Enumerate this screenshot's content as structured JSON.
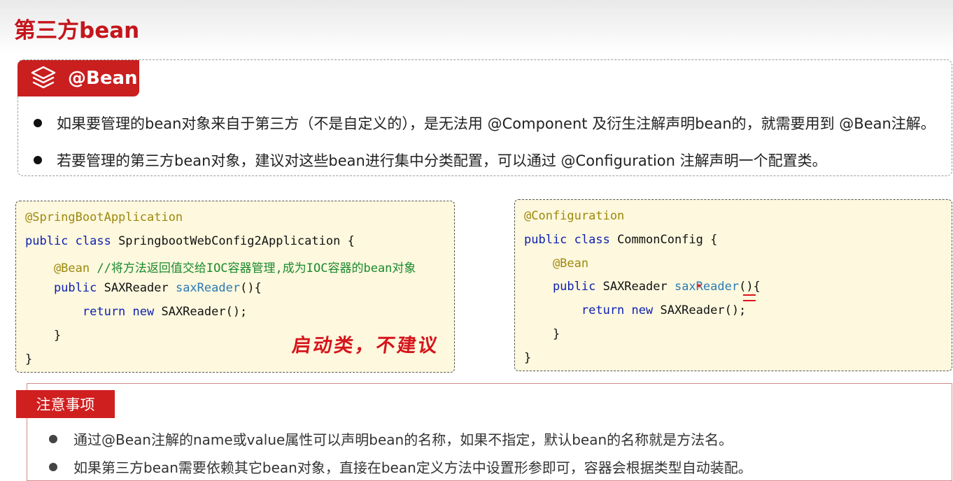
{
  "page": {
    "title": "第三方bean"
  },
  "bean_section": {
    "tab_label": "@Bean",
    "tab_icon": "layers-icon",
    "bullets": [
      "如果要管理的bean对象来自于第三方（不是自定义的），是无法用 @Component 及衍生注解声明bean的，就需要用到 @Bean注解。",
      "若要管理的第三方bean对象，建议对这些bean进行集中分类配置，可以通过 @Configuration 注解声明一个配置类。"
    ]
  },
  "code_left": {
    "lines": [
      [
        {
          "t": "@SpringBootApplication",
          "c": "ann"
        }
      ],
      [
        {
          "t": "public class ",
          "c": "kw"
        },
        {
          "t": "SpringbootWebConfig2Application {",
          "c": "pl"
        }
      ],
      [
        {
          "t": "    @Bean ",
          "c": "ann"
        },
        {
          "t": "//将方法返回值交给IOC容器管理,成为IOC容器的bean对象",
          "c": "cm"
        }
      ],
      [
        {
          "t": "    public ",
          "c": "kw"
        },
        {
          "t": "SAXReader ",
          "c": "pl"
        },
        {
          "t": "saxReader",
          "c": "fn"
        },
        {
          "t": "(){",
          "c": "pl"
        }
      ],
      [
        {
          "t": "        return new ",
          "c": "kw"
        },
        {
          "t": "SAXReader();",
          "c": "pl"
        }
      ],
      [
        {
          "t": "    }",
          "c": "pl"
        }
      ],
      [
        {
          "t": "}",
          "c": "pl"
        }
      ]
    ],
    "handwritten_note": "启动类，不建议"
  },
  "code_right": {
    "lines": [
      [
        {
          "t": "@Configuration",
          "c": "ann"
        }
      ],
      [
        {
          "t": "public class ",
          "c": "kw"
        },
        {
          "t": "CommonConfig {",
          "c": "pl"
        }
      ],
      [
        {
          "t": "    @Bean",
          "c": "ann"
        }
      ],
      [
        {
          "t": "    public ",
          "c": "kw"
        },
        {
          "t": "SAXReader ",
          "c": "pl"
        },
        {
          "t": "saxReader",
          "c": "fn"
        },
        {
          "t": "(){",
          "c": "pl"
        }
      ],
      [
        {
          "t": "        return new ",
          "c": "kw"
        },
        {
          "t": "SAXReader();",
          "c": "pl"
        }
      ],
      [
        {
          "t": "    }",
          "c": "pl"
        }
      ],
      [
        {
          "t": "}",
          "c": "pl"
        }
      ]
    ]
  },
  "notes": {
    "tab_label": "注意事项",
    "items": [
      "通过@Bean注解的name或value属性可以声明bean的名称，如果不指定，默认bean的名称就是方法名。",
      "如果第三方bean需要依赖其它bean对象，直接在bean定义方法中设置形参即可，容器会根据类型自动装配。"
    ]
  },
  "colors": {
    "accent_red": "#c91f1f",
    "code_background": "#fdf8de",
    "annotation": "#9e880d",
    "keyword": "#0d1fb0",
    "method": "#2a7bb5",
    "comment": "#1a8a2e"
  }
}
